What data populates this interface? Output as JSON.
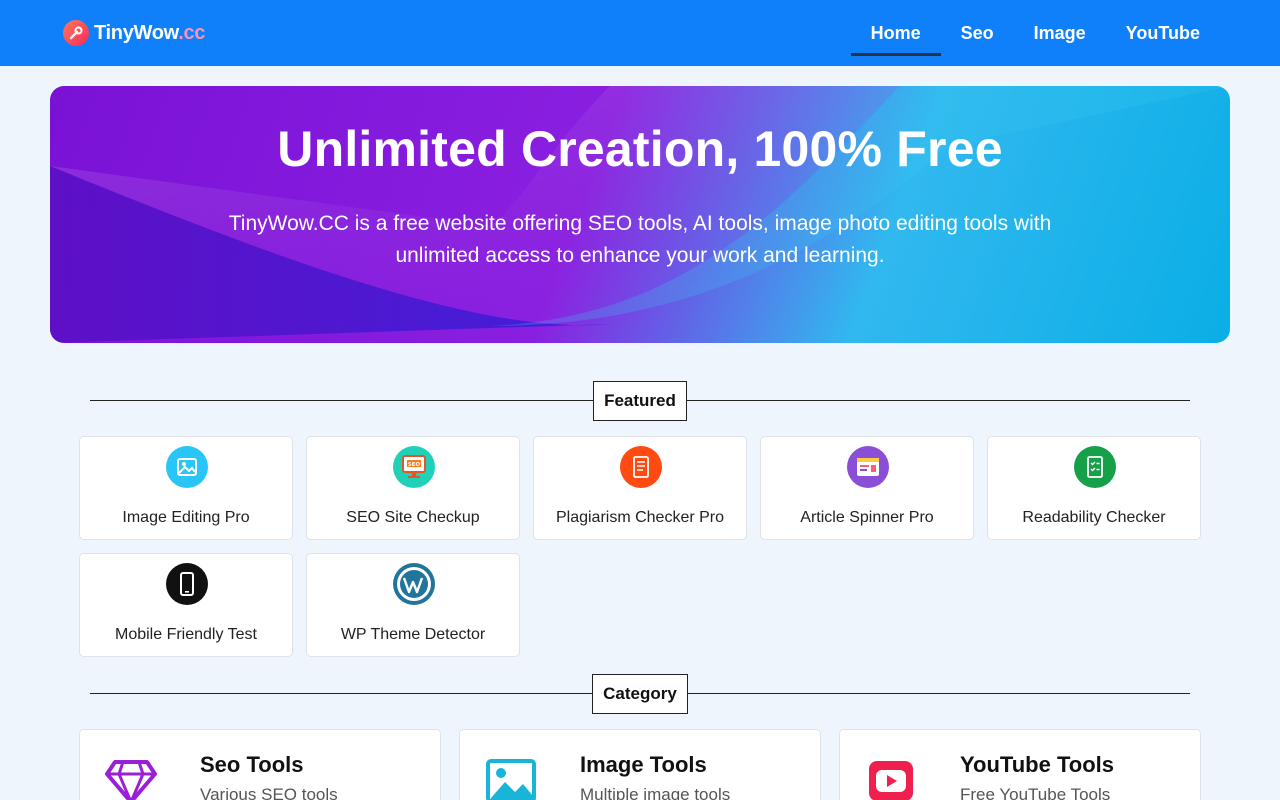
{
  "header": {
    "logo": {
      "name": "TinyWow",
      "suffix": ".cc",
      "icon": "wrench-icon"
    },
    "nav": [
      {
        "label": "Home",
        "active": true
      },
      {
        "label": "Seo",
        "active": false
      },
      {
        "label": "Image",
        "active": false
      },
      {
        "label": "YouTube",
        "active": false
      }
    ]
  },
  "hero": {
    "title": "Unlimited Creation, 100% Free",
    "description": "TinyWow.CC is a free website offering SEO tools, AI tools, image photo editing tools with unlimited access to enhance your work and learning."
  },
  "featured": {
    "label": "Featured",
    "tools": [
      {
        "label": "Image Editing Pro",
        "icon": "image-editing-icon",
        "color": "#29c5f6"
      },
      {
        "label": "SEO Site Checkup",
        "icon": "seo-monitor-icon",
        "color": "#1fd1b9"
      },
      {
        "label": "Plagiarism Checker Pro",
        "icon": "document-check-icon",
        "color": "#ff4b12"
      },
      {
        "label": "Article Spinner Pro",
        "icon": "article-window-icon",
        "color": "#8a4fd6"
      },
      {
        "label": "Readability Checker",
        "icon": "checklist-icon",
        "color": "#16a04a"
      },
      {
        "label": "Mobile Friendly Test",
        "icon": "mobile-phone-icon",
        "color": "#111111"
      },
      {
        "label": "WP Theme Detector",
        "icon": "wordpress-icon",
        "color": "#21759b"
      }
    ]
  },
  "category": {
    "label": "Category",
    "items": [
      {
        "title": "Seo Tools",
        "desc": "Various SEO tools",
        "icon": "diamond-icon",
        "color": "#9b1fd6"
      },
      {
        "title": "Image Tools",
        "desc": "Multiple image tools",
        "icon": "image-icon",
        "color": "#19b5d8"
      },
      {
        "title": "YouTube Tools",
        "desc": "Free YouTube Tools",
        "icon": "youtube-icon",
        "color": "#ef1f4e"
      }
    ]
  }
}
